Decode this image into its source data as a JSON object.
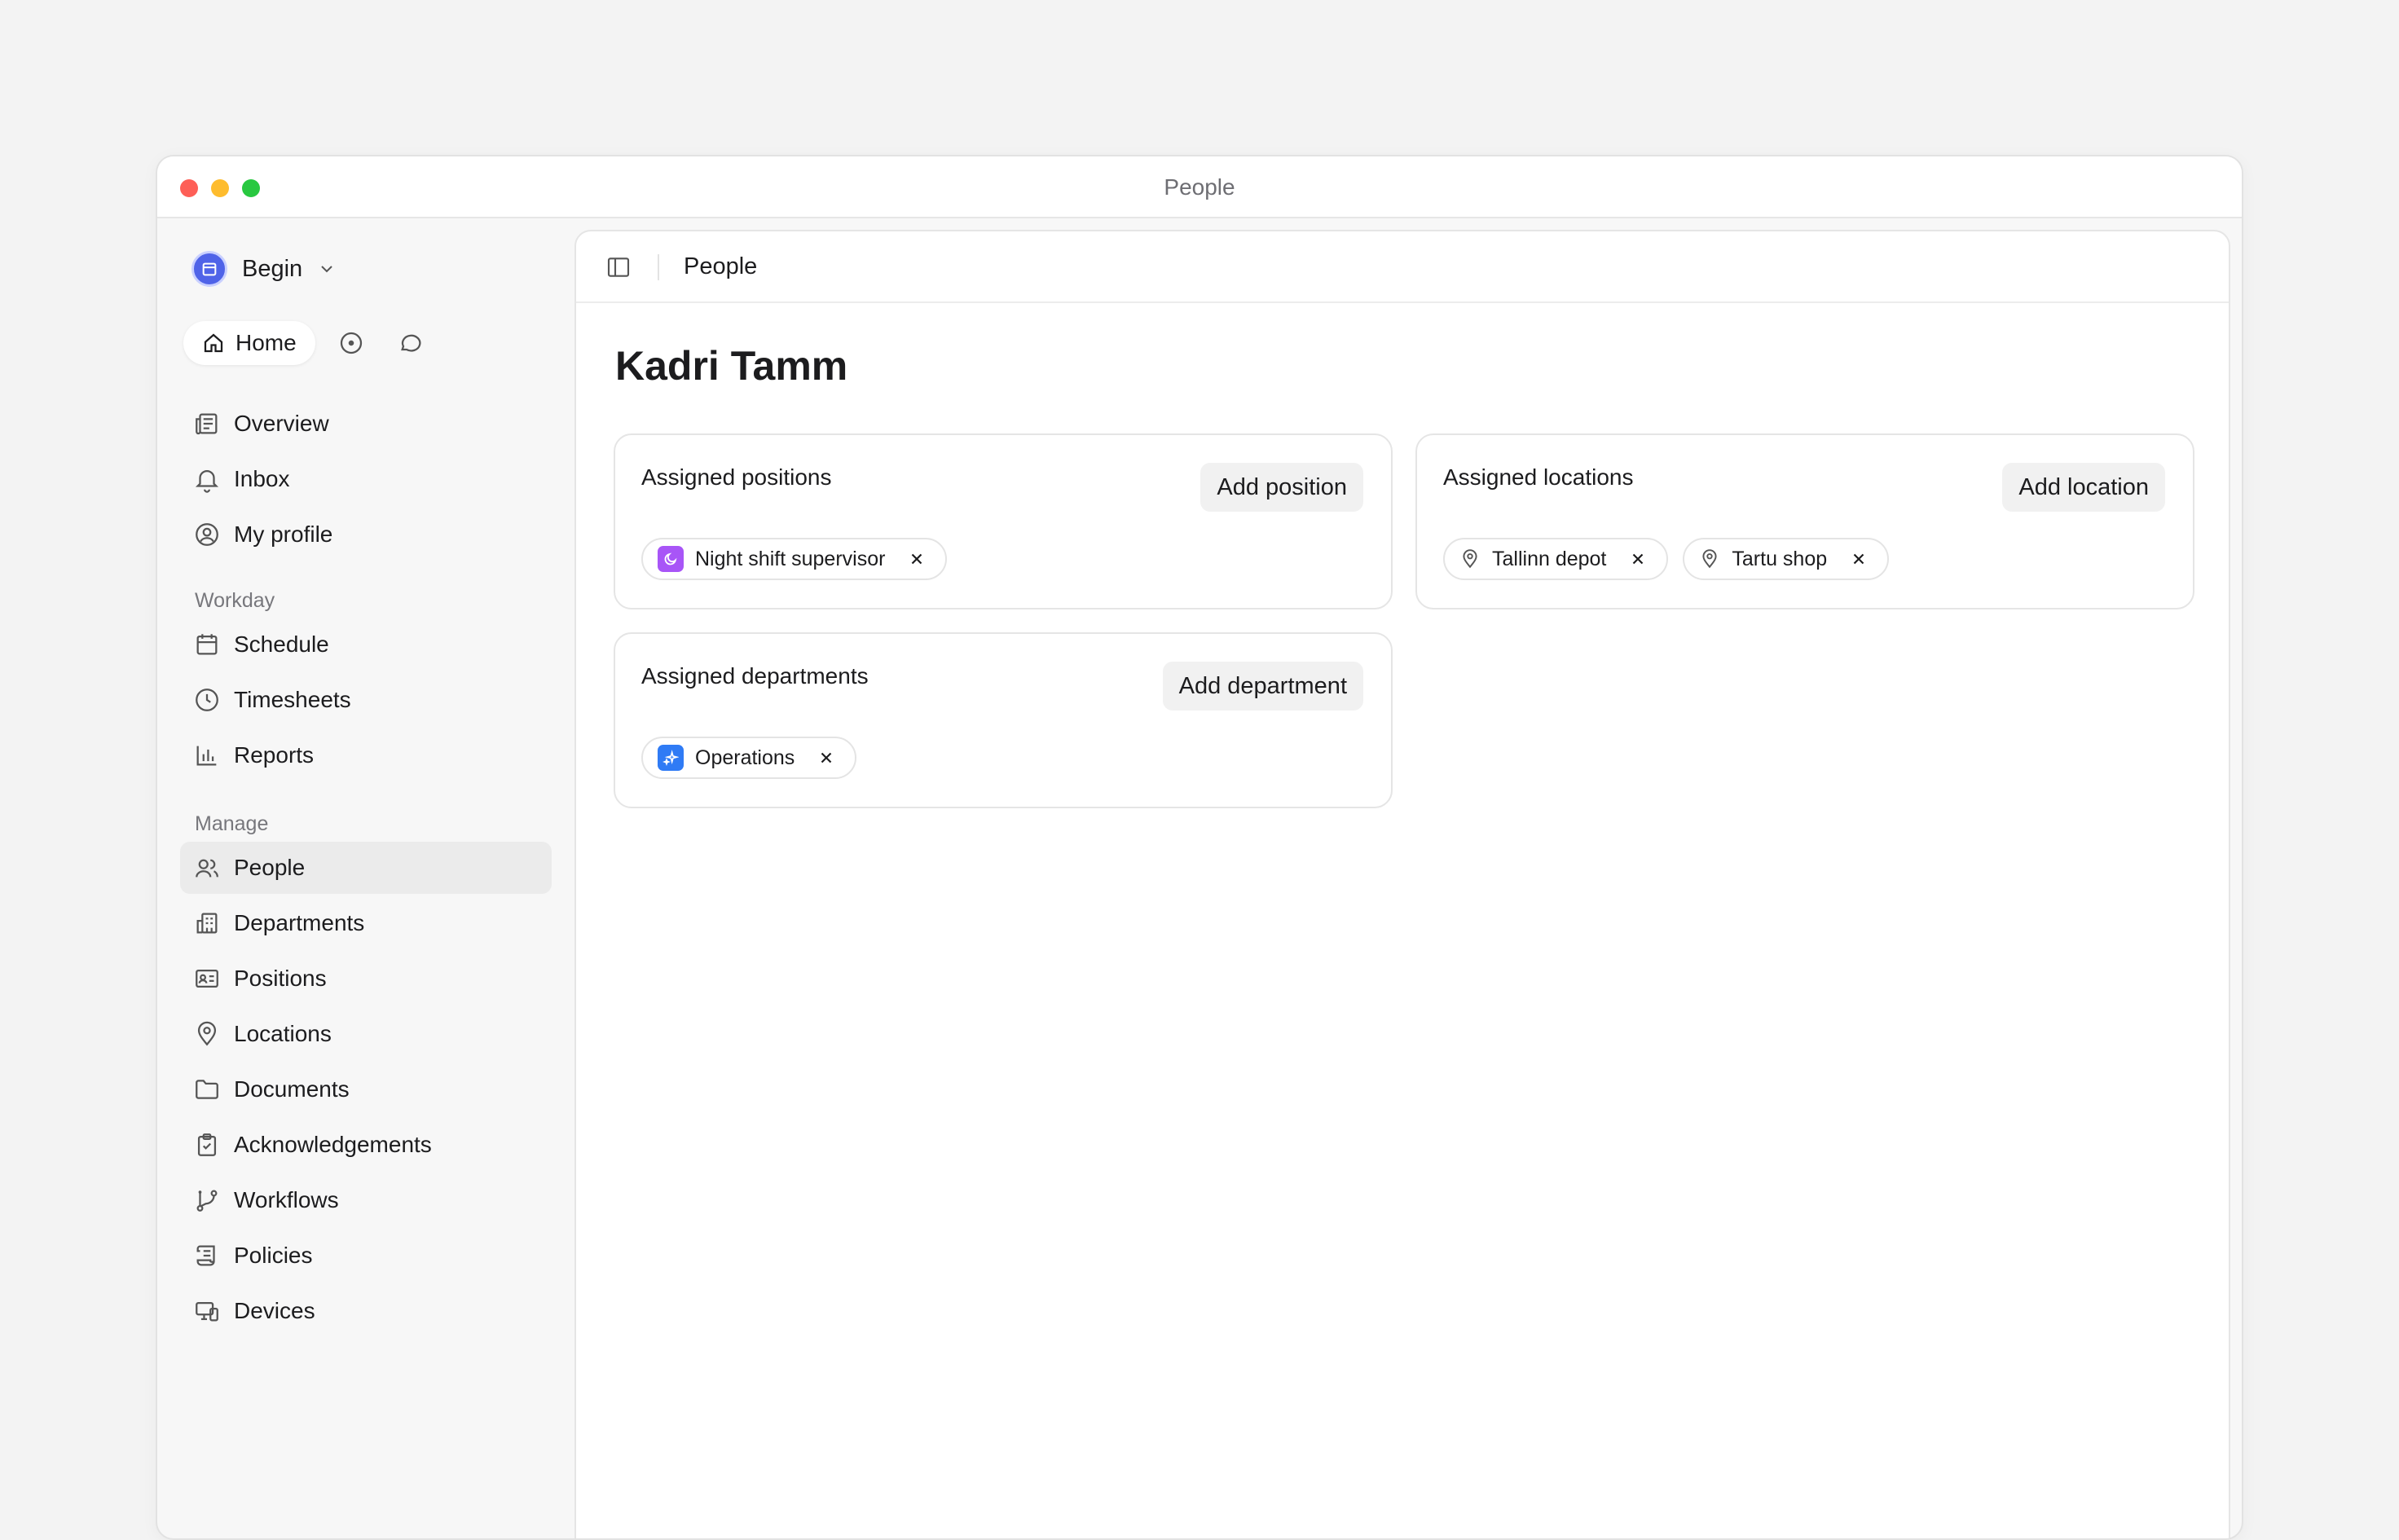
{
  "window": {
    "title": "People"
  },
  "sidebar": {
    "workspace_name": "Begin",
    "home_label": "Home",
    "top_items": [
      {
        "label": "Overview",
        "icon": "newspaper-icon"
      },
      {
        "label": "Inbox",
        "icon": "bell-icon"
      },
      {
        "label": "My profile",
        "icon": "user-circle-icon"
      }
    ],
    "workday_label": "Workday",
    "workday_items": [
      {
        "label": "Schedule",
        "icon": "calendar-icon"
      },
      {
        "label": "Timesheets",
        "icon": "clock-icon"
      },
      {
        "label": "Reports",
        "icon": "bar-chart-icon"
      }
    ],
    "manage_label": "Manage",
    "manage_items": [
      {
        "label": "People",
        "icon": "users-icon",
        "active": true
      },
      {
        "label": "Departments",
        "icon": "building-icon"
      },
      {
        "label": "Positions",
        "icon": "id-card-icon"
      },
      {
        "label": "Locations",
        "icon": "map-pin-icon"
      },
      {
        "label": "Documents",
        "icon": "folder-icon"
      },
      {
        "label": "Acknowledgements",
        "icon": "clipboard-check-icon"
      },
      {
        "label": "Workflows",
        "icon": "git-branch-icon"
      },
      {
        "label": "Policies",
        "icon": "scroll-icon"
      },
      {
        "label": "Devices",
        "icon": "devices-icon"
      }
    ]
  },
  "main": {
    "breadcrumb": "People",
    "person_name": "Kadri Tamm",
    "positions_card": {
      "title": "Assigned positions",
      "button": "Add position",
      "chips": [
        {
          "label": "Night shift supervisor",
          "color": "#a855f7"
        }
      ]
    },
    "locations_card": {
      "title": "Assigned locations",
      "button": "Add location",
      "chips": [
        {
          "label": "Tallinn depot"
        },
        {
          "label": "Tartu shop"
        }
      ]
    },
    "departments_card": {
      "title": "Assigned departments",
      "button": "Add department",
      "chips": [
        {
          "label": "Operations",
          "color": "#2f7bf5"
        }
      ]
    }
  },
  "colors": {
    "accent": "#4f63e8",
    "position_badge": "#a855f7",
    "department_badge": "#2f7bf5",
    "close": "#fe5f57",
    "minimize": "#febc2e",
    "maximize": "#28c840"
  }
}
